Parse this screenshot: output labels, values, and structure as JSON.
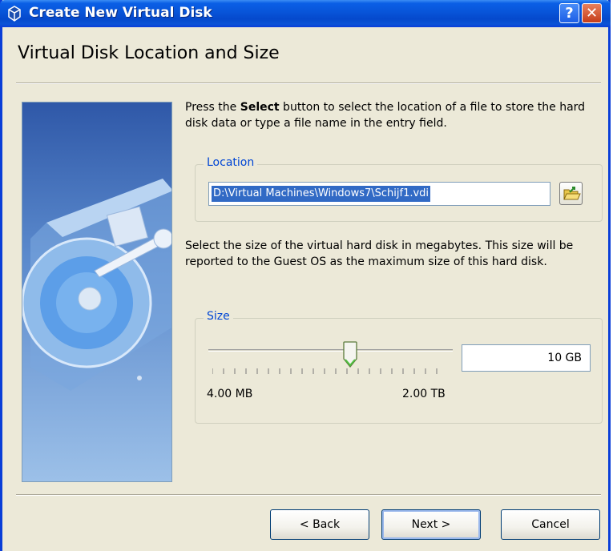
{
  "window": {
    "title": "Create New Virtual Disk"
  },
  "titlebar": {
    "help_label": "?",
    "close_label": "✕"
  },
  "page": {
    "heading": "Virtual Disk Location and Size"
  },
  "intro": {
    "prefix": "Press the ",
    "bold_word": "Select",
    "suffix": " button to select the location of a file to store the hard disk data or type a file name in the entry field."
  },
  "location": {
    "legend": "Location",
    "value": "D:\\Virtual Machines\\Windows7\\Schijf1.vdi",
    "select_icon": "folder-open-icon"
  },
  "size_description": "Select the size of the virtual hard disk in megabytes. This size will be reported to the Guest OS as the maximum size of this hard disk.",
  "size": {
    "legend": "Size",
    "min_label": "4.00 MB",
    "max_label": "2.00 TB",
    "value": "10 GB",
    "slider_fraction": 0.58
  },
  "buttons": {
    "back": "< Back",
    "next": "Next >",
    "cancel": "Cancel"
  },
  "colors": {
    "titlebar": "#0a53d6",
    "accent": "#0046d5",
    "selection": "#316ac5"
  }
}
